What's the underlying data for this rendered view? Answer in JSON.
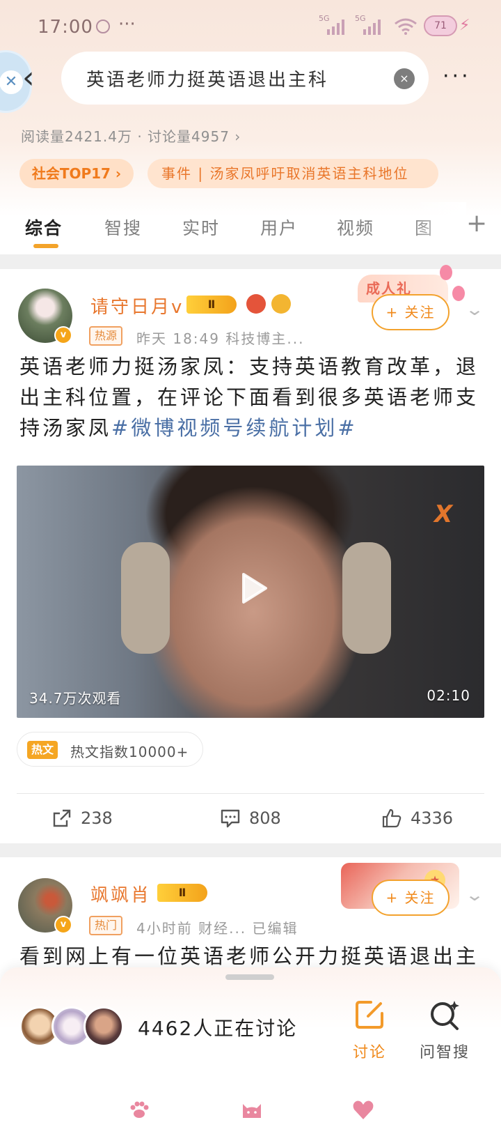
{
  "status_bar": {
    "time": "17:00",
    "more": "···",
    "network_1": "5G",
    "network_2": "5G",
    "battery": "71"
  },
  "header": {
    "search_query": "英语老师力挺英语退出主科",
    "clear_icon": "×",
    "more_label": "···",
    "stats": "阅读量2421.4万 · 讨论量4957 ›",
    "rank_badge": "社会TOP17 ›",
    "event_label": "事件 | 汤家凤呼吁取消英语主科地位"
  },
  "tabs": [
    {
      "label": "综合"
    },
    {
      "label": "智搜"
    },
    {
      "label": "实时"
    },
    {
      "label": "用户"
    },
    {
      "label": "视频"
    },
    {
      "label": "图"
    }
  ],
  "posts": [
    {
      "username": "请守日月v",
      "vip_level": "Ⅱ",
      "tag": "热源",
      "meta": "昨天 18:49  科技博主...",
      "follow_label": "+ 关注",
      "promo_label": "成人礼",
      "text": "英语老师力挺汤家凤：支持英语教育改革，退出主科位置，在评论下面看到很多英语老师支持汤家凤",
      "hashtag": "#微博视频号续航计划#",
      "video": {
        "view_count": "34.7万次观看",
        "duration": "02:10",
        "chair_logo": "X"
      },
      "hot_tag": "热文",
      "hot_index": "热文指数10000+",
      "actions": {
        "share": "238",
        "comment": "808",
        "like": "4336"
      }
    },
    {
      "username": "飒飒肖",
      "vip_level": "Ⅱ",
      "tag": "热门",
      "meta": "4小时前  财经...  已编辑",
      "follow_label": "+ 关注",
      "text": "看到网上有一位英语老师公开力挺英语退出主"
    }
  ],
  "bottom_sheet": {
    "discussing": "4462人正在讨论",
    "discuss_label": "讨论",
    "ask_label": "问智搜"
  },
  "colors": {
    "accent": "#f08a1c",
    "username": "#e8772e",
    "hashtag": "#4a6fa5",
    "tab_underline": "#f3a32a"
  }
}
